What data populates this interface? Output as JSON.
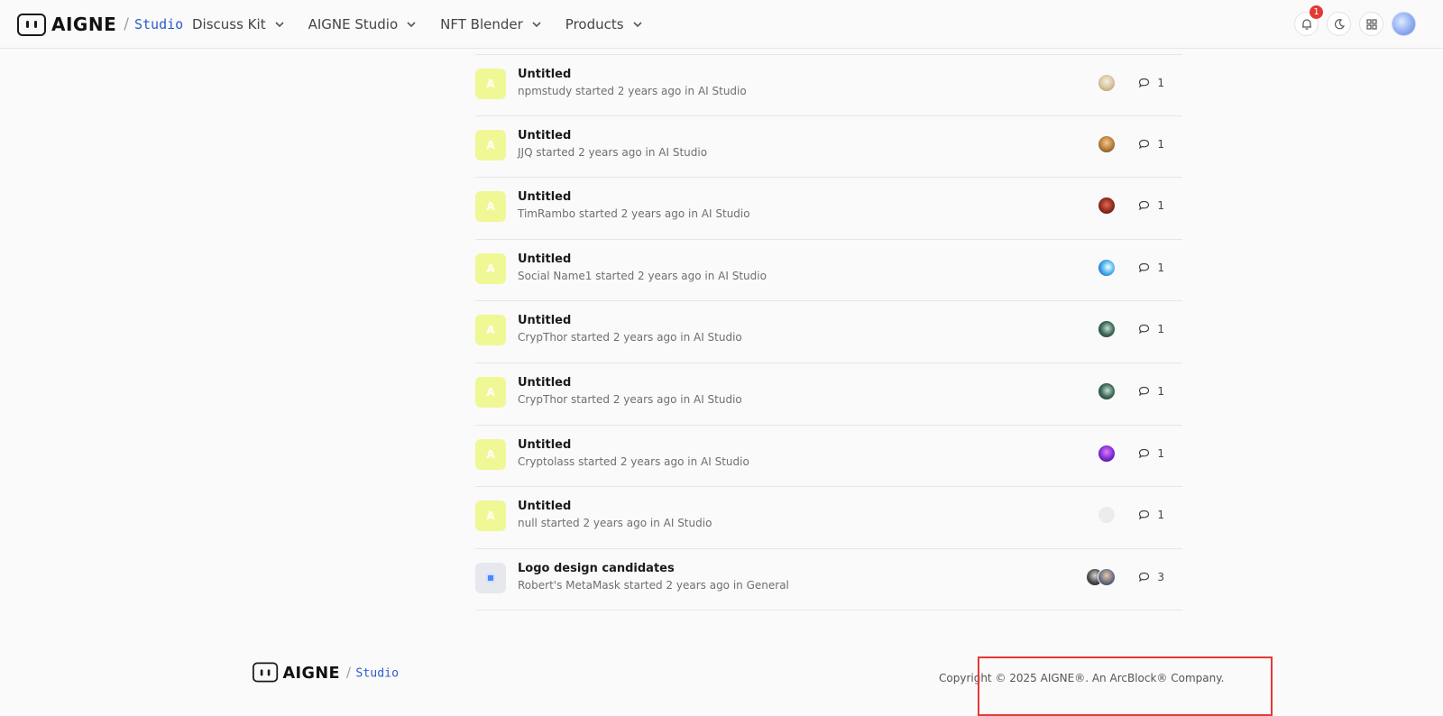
{
  "header": {
    "brand": "AIGNE",
    "brand_sub": "Studio",
    "nav": [
      "Discuss Kit",
      "AIGNE Studio",
      "NFT Blender",
      "Products"
    ],
    "notification_count": "1"
  },
  "topics": [
    {
      "icon_letter": "A",
      "title": "Untitled",
      "meta": "npmstudy started 2 years ago in AI Studio",
      "replies": "1"
    },
    {
      "icon_letter": "A",
      "title": "Untitled",
      "meta": "JJQ started 2 years ago in AI Studio",
      "replies": "1"
    },
    {
      "icon_letter": "A",
      "title": "Untitled",
      "meta": "TimRambo started 2 years ago in AI Studio",
      "replies": "1"
    },
    {
      "icon_letter": "A",
      "title": "Untitled",
      "meta": "Social Name1 started 2 years ago in AI Studio",
      "replies": "1"
    },
    {
      "icon_letter": "A",
      "title": "Untitled",
      "meta": "CrypThor started 2 years ago in AI Studio",
      "replies": "1"
    },
    {
      "icon_letter": "A",
      "title": "Untitled",
      "meta": "CrypThor started 2 years ago in AI Studio",
      "replies": "1"
    },
    {
      "icon_letter": "A",
      "title": "Untitled",
      "meta": "Cryptolass started 2 years ago in AI Studio",
      "replies": "1"
    },
    {
      "icon_letter": "A",
      "title": "Untitled",
      "meta": "null started 2 years ago in AI Studio",
      "replies": "1"
    },
    {
      "icon_letter": "",
      "title": "Logo design candidates",
      "meta": "Robert's MetaMask started 2 years ago in General",
      "replies": "3"
    }
  ],
  "footer": {
    "brand": "AIGNE",
    "brand_sub": "Studio",
    "copyright": "Copyright © 2025 AIGNE®. An ArcBlock® Company."
  },
  "colors": {
    "accent": "#2f5bcd",
    "topic_icon_bg": "#eff894",
    "badge": "#e53935",
    "highlight_box": "#e53935"
  }
}
